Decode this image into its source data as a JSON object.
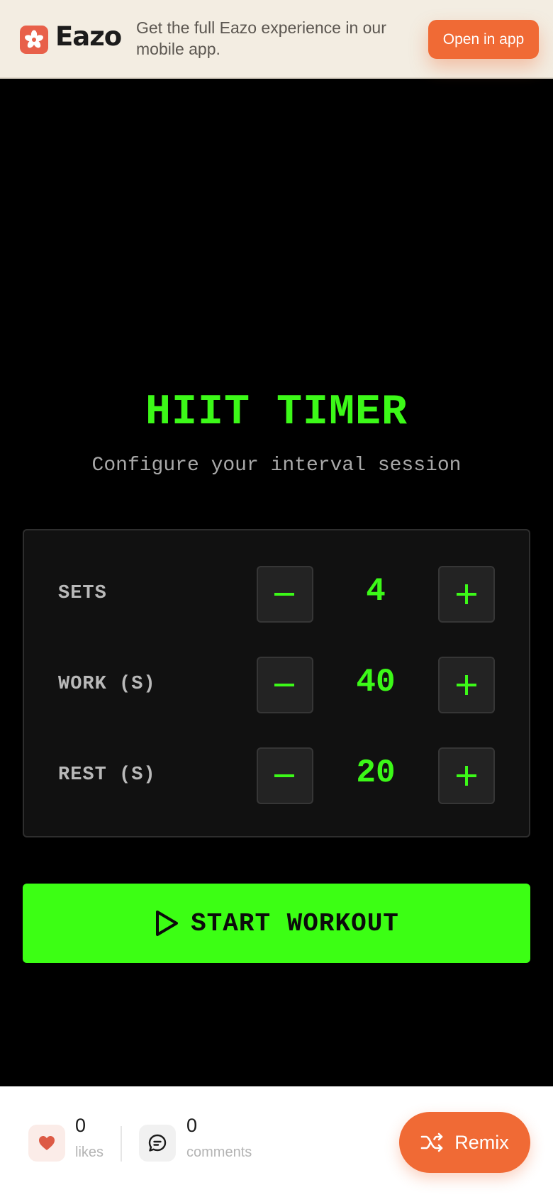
{
  "banner": {
    "brand": "Eazo",
    "message": "Get the full Eazo experience in our mobile app.",
    "open_button": "Open in app"
  },
  "timer": {
    "title": "HIIT TIMER",
    "subtitle": "Configure your interval session",
    "rows": [
      {
        "label": "SETS",
        "value": "4",
        "minus": "−",
        "plus": "+"
      },
      {
        "label": "WORK (S)",
        "value": "40",
        "minus": "−",
        "plus": "+"
      },
      {
        "label": "REST (S)",
        "value": "20",
        "minus": "−",
        "plus": "+"
      }
    ],
    "start_button": "START WORKOUT"
  },
  "footer": {
    "likes_count": "0",
    "likes_label": "likes",
    "comments_count": "0",
    "comments_label": "comments",
    "remix_button": "Remix"
  },
  "colors": {
    "accent_green": "#3cf918",
    "brand_orange": "#f06a35",
    "banner_bg": "#f3ede2"
  },
  "icons": [
    "eazo-logo-icon",
    "minus-icon",
    "plus-icon",
    "play-icon",
    "heart-icon",
    "comment-icon",
    "shuffle-icon"
  ]
}
